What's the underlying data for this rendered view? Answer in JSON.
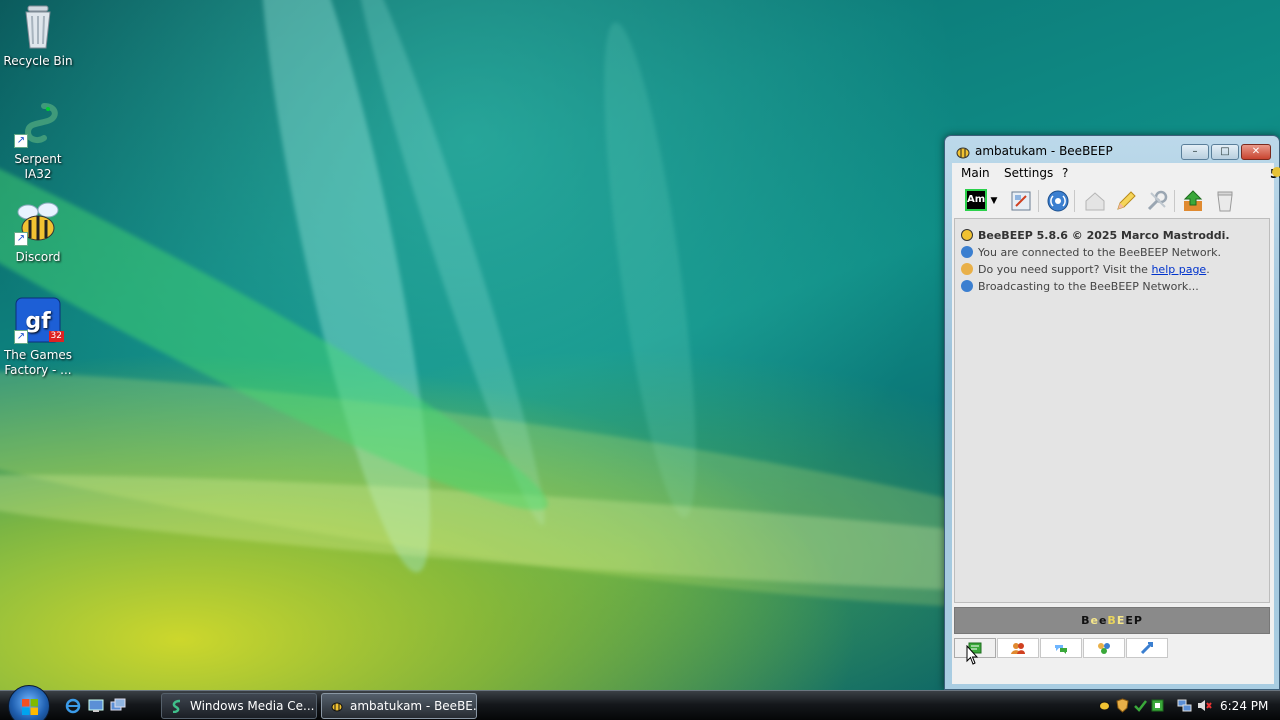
{
  "desktop": {
    "icons": [
      {
        "label": "Recycle Bin"
      },
      {
        "label": "Serpent IA32"
      },
      {
        "label": "Discord"
      },
      {
        "label": "The Games Factory - ...",
        "badge": "32"
      }
    ]
  },
  "window": {
    "title": "ambatukam - BeeBEEP",
    "controls": {
      "minimize": "–",
      "maximize": "□",
      "close": "✕"
    },
    "menu": {
      "main": "Main",
      "settings": "Settings",
      "help": "?"
    },
    "version": "5.8.6",
    "toolbar": {
      "status_label": "Am",
      "icons": [
        "status-dropdown-icon",
        "edit-profile-icon",
        "network-broadcast-icon",
        "home-icon",
        "pencil-icon",
        "tools-icon",
        "update-arrow-icon",
        "trash-icon"
      ]
    },
    "messages": {
      "line1": "BeeBEEP 5.8.6 © 2025 Marco Mastroddi.",
      "line2": "You are connected to the BeeBEEP Network.",
      "line3_prefix": "Do you need support? Visit the ",
      "line3_link": "help page",
      "line3_suffix": ".",
      "line4": "Broadcasting to the BeeBEEP Network..."
    },
    "banner": {
      "l1": "B",
      "l2": "e",
      "l3": "e",
      "l4": "B",
      "l5": "E",
      "l6": "E",
      "l7": "P"
    },
    "tabs": [
      "chat-tab-icon",
      "users-tab-icon",
      "groups-tab-icon",
      "network-tab-icon",
      "shares-tab-icon"
    ]
  },
  "taskbar": {
    "tasks": [
      {
        "label": "Windows Media Ce..."
      },
      {
        "label": "ambatukam - BeeBE..."
      }
    ],
    "clock": "6:24 PM"
  },
  "colors": {
    "accent": "#1f5fb0",
    "link": "#0033cc",
    "window_frame": "#a9cde2"
  }
}
